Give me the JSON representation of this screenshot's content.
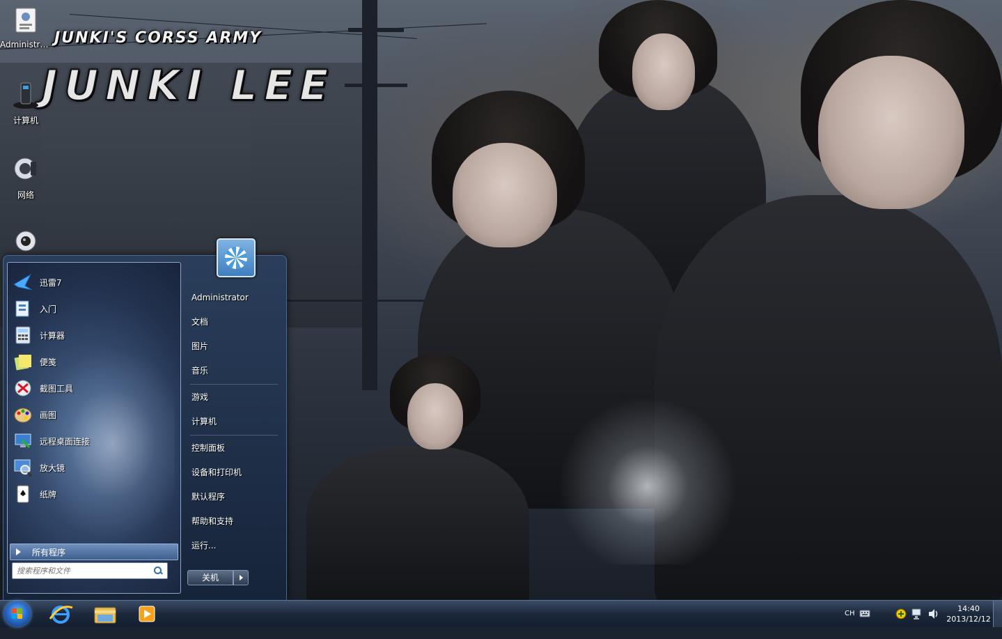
{
  "wallpaper": {
    "logo_top": "JUNKI'S CORSS ARMY",
    "logo_main": "JUNKI  LEE"
  },
  "desktop_icons": [
    {
      "label": "Administra...",
      "icon": "user-folder-icon"
    },
    {
      "label": "计算机",
      "icon": "computer-icon"
    },
    {
      "label": "网络",
      "icon": "network-icon"
    },
    {
      "label": "",
      "icon": "webcam-icon"
    }
  ],
  "start_menu": {
    "programs": [
      {
        "label": "迅雷7",
        "icon": "thunder-bird-icon"
      },
      {
        "label": "入门",
        "icon": "getting-started-icon"
      },
      {
        "label": "计算器",
        "icon": "calculator-icon"
      },
      {
        "label": "便笺",
        "icon": "sticky-notes-icon"
      },
      {
        "label": "截图工具",
        "icon": "snipping-tool-icon"
      },
      {
        "label": "画图",
        "icon": "paint-icon"
      },
      {
        "label": "远程桌面连接",
        "icon": "remote-desktop-icon"
      },
      {
        "label": "放大镜",
        "icon": "magnifier-icon"
      },
      {
        "label": "纸牌",
        "icon": "solitaire-icon"
      }
    ],
    "all_programs": "所有程序",
    "search_placeholder": "搜索程序和文件",
    "right_items": [
      {
        "label": "Administrator"
      },
      {
        "label": "文档"
      },
      {
        "label": "图片"
      },
      {
        "label": "音乐"
      },
      {
        "label": "游戏"
      },
      {
        "label": "计算机"
      },
      {
        "label": "控制面板"
      },
      {
        "label": "设备和打印机"
      },
      {
        "label": "默认程序"
      },
      {
        "label": "帮助和支持"
      },
      {
        "label": "运行..."
      }
    ],
    "shutdown_label": "关机"
  },
  "taskbar": {
    "pinned": [
      {
        "name": "internet-explorer",
        "icon": "ie-icon"
      },
      {
        "name": "explorer",
        "icon": "folder-icon"
      },
      {
        "name": "media-player",
        "icon": "media-player-icon"
      }
    ],
    "language": "CH",
    "time": "14:40",
    "date": "2013/12/12"
  },
  "colors": {
    "start_accent": "#2a6fcf",
    "menu_bg": "#22324f",
    "taskbar_bg": "#1c2840"
  }
}
